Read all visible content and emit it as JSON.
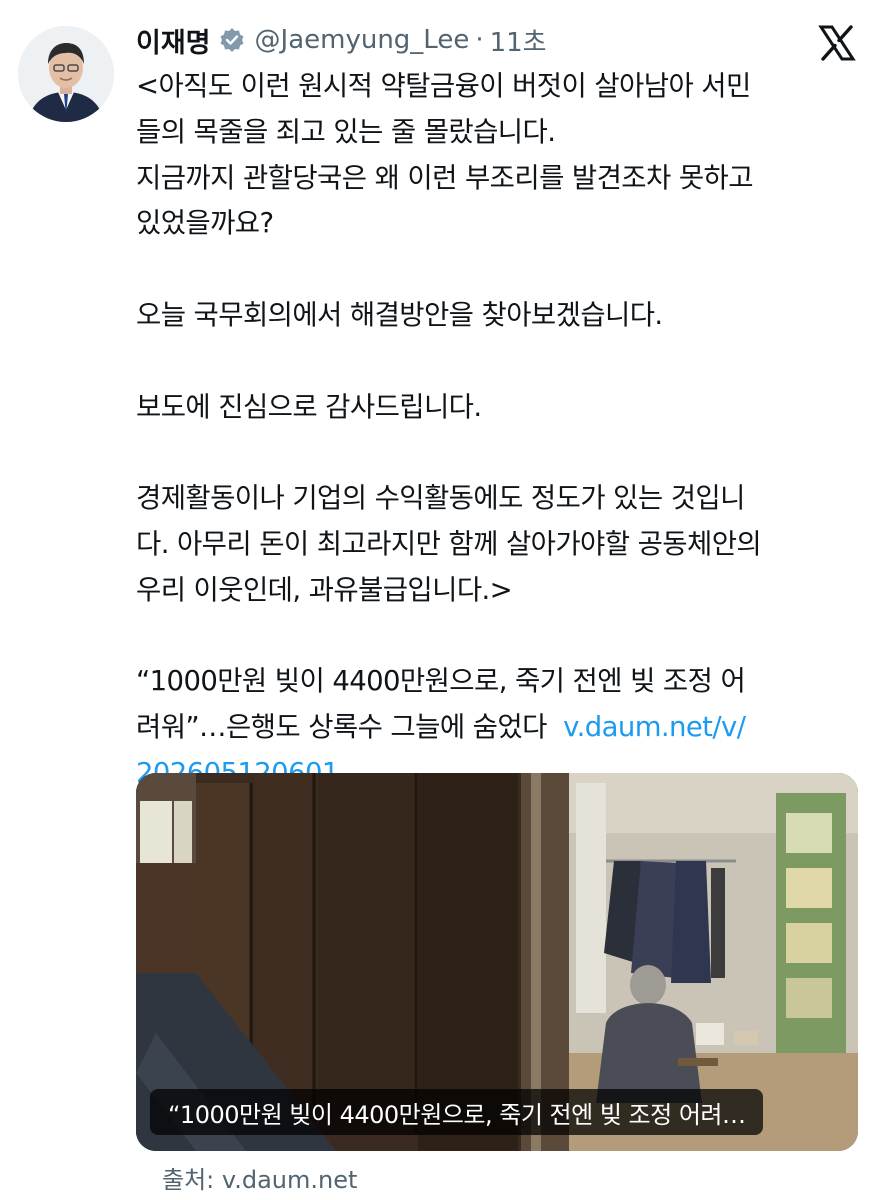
{
  "author": {
    "name": "이재명",
    "handle": "@Jaemyung_Lee",
    "separator": "·",
    "time": "11초"
  },
  "tweet": {
    "lines": [
      "<아직도 이런 원시적 약탈금융이 버젓이 살아남아 서민",
      "들의 목줄을 죄고 있는 줄 몰랐습니다.",
      "지금까지 관할당국은 왜 이런 부조리를 발견조차 못하고",
      "있었을까요?",
      "",
      "오늘 국무회의에서 해결방안을 찾아보겠습니다.",
      "",
      "보도에 진심으로 감사드립니다.",
      "",
      "경제활동이나 기업의 수익활동에도 정도가 있는 것입니",
      "다. 아무리 돈이 최고라지만 함께 살아가야할 공동체안의",
      "우리 이웃인데, 과유불급입니다.>",
      "",
      "“1000만원 빚이 4400만원으로, 죽기 전엔 빚 조정 어"
    ],
    "headline_cont": "려워”…은행도 상록수 그늘에 숨었다",
    "link_part1": "v.daum.net/v/",
    "link_part2": "202605120601…"
  },
  "card": {
    "caption": "“1000만원 빚이 4400만원으로, 죽기 전엔 빚 조정 어려…",
    "source": "출처: v.daum.net"
  },
  "icons": {
    "verified": "verified-badge-icon",
    "platform": "x-logo-icon"
  },
  "colors": {
    "link": "#1d9bf0",
    "secondary_text": "#536471",
    "primary_text": "#0f1419"
  }
}
